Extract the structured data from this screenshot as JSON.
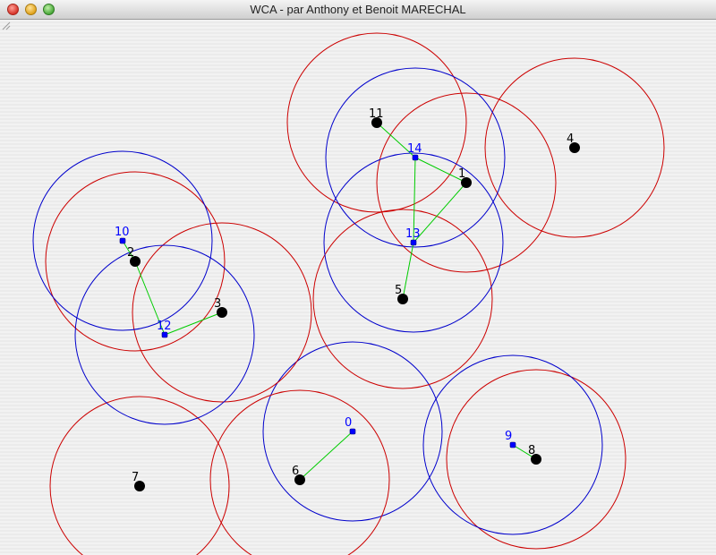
{
  "window": {
    "title": "WCA - par Anthony et Benoit MARECHAL"
  },
  "colors": {
    "normal_node": "#000000",
    "head_node": "#0000ff",
    "normal_range": "#cc0000",
    "head_range": "#0000cc",
    "link": "#00cc00"
  },
  "nodes": [
    {
      "id": "0",
      "kind": "head"
    },
    {
      "id": "1",
      "kind": "normal"
    },
    {
      "id": "2",
      "kind": "normal"
    },
    {
      "id": "3",
      "kind": "normal"
    },
    {
      "id": "4",
      "kind": "normal"
    },
    {
      "id": "5",
      "kind": "normal"
    },
    {
      "id": "6",
      "kind": "normal"
    },
    {
      "id": "7",
      "kind": "normal"
    },
    {
      "id": "8",
      "kind": "normal"
    },
    {
      "id": "9",
      "kind": "head"
    },
    {
      "id": "10",
      "kind": "head"
    },
    {
      "id": "11",
      "kind": "normal"
    },
    {
      "id": "12",
      "kind": "head"
    },
    {
      "id": "13",
      "kind": "head"
    },
    {
      "id": "14",
      "kind": "head"
    }
  ],
  "links": [
    [
      "11",
      "14"
    ],
    [
      "14",
      "1"
    ],
    [
      "14",
      "13"
    ],
    [
      "1",
      "13"
    ],
    [
      "13",
      "5"
    ],
    [
      "10",
      "2"
    ],
    [
      "2",
      "12"
    ],
    [
      "12",
      "3"
    ],
    [
      "0",
      "6"
    ],
    [
      "9",
      "8"
    ]
  ]
}
